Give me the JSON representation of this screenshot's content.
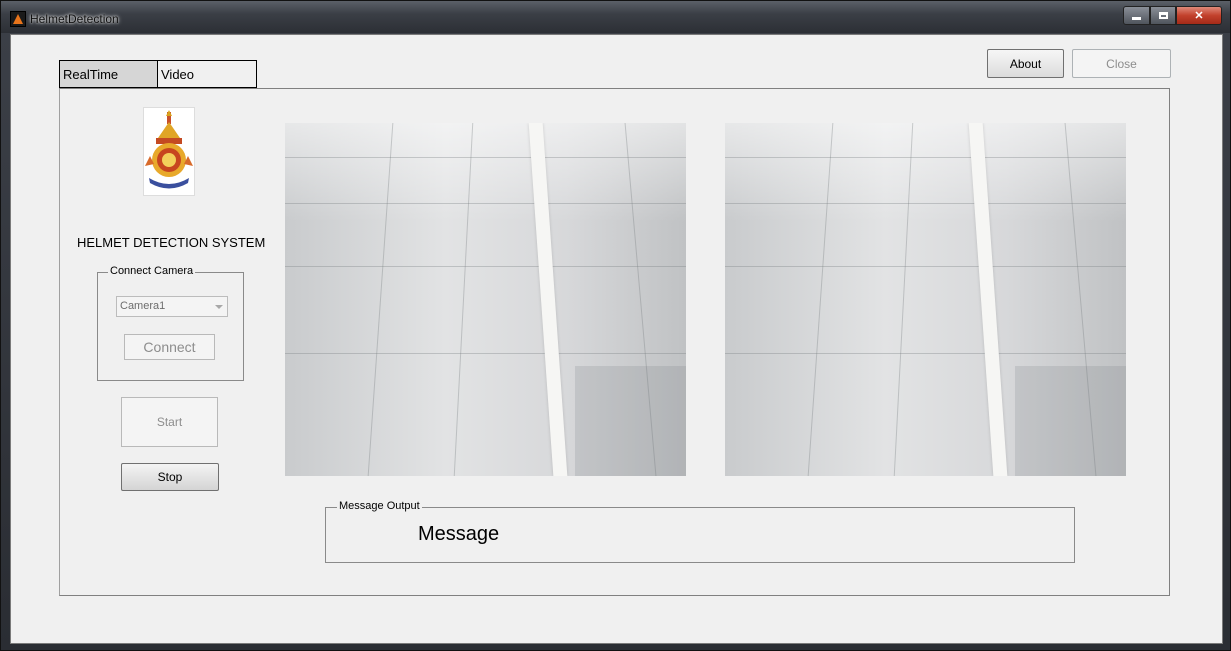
{
  "window": {
    "title": "HelmetDetection",
    "controls": [
      "minimize-icon",
      "maximize-icon",
      "close-icon"
    ]
  },
  "toolbar": {
    "about_label": "About",
    "close_label": "Close"
  },
  "tabs": [
    {
      "label": "RealTime",
      "selected": true
    },
    {
      "label": "Video",
      "selected": false
    }
  ],
  "sidebar": {
    "system_title": "HELMET DETECTION SYSTEM",
    "connect_group_label": "Connect Camera",
    "camera_selected": "Camera1",
    "connect_label": "Connect",
    "start_label": "Start",
    "stop_label": "Stop"
  },
  "message_panel": {
    "group_label": "Message Output",
    "text": "Message"
  },
  "colors": {
    "window_bg": "#f0f0f0",
    "titlebar": "#3b3f46",
    "close_button": "#c2412c",
    "disabled_text": "#8d8d8d"
  }
}
